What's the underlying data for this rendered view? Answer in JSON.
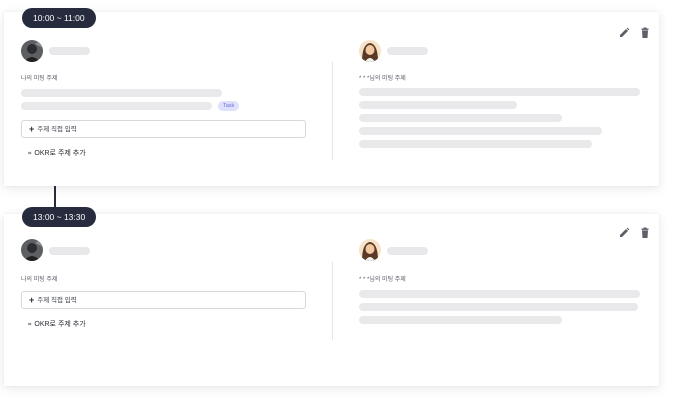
{
  "meetings": [
    {
      "time": "10:00 ~ 11:00",
      "my_topics_label": "나의 미팅 주제",
      "other_topics_label": "* * *님의 미팅 주제",
      "task_tag": "Task",
      "input_label": "주제 직접 입력",
      "okr_label": "OKR로 주제 추가"
    },
    {
      "time": "13:00 ~ 13:30",
      "my_topics_label": "나의 미팅 주제",
      "other_topics_label": "* * *님의 미팅 주제",
      "input_label": "주제 직접 입력",
      "okr_label": "OKR로 주제 추가"
    }
  ],
  "icons": {
    "edit": "pencil-icon",
    "delete": "trash-icon",
    "add": "plus-icon",
    "okr": "okr-icon"
  },
  "colors": {
    "pill": "#262b3e",
    "tag_bg": "#dfe0fb",
    "tag_text": "#6b6fd8",
    "skeleton": "#e9e9eb"
  }
}
